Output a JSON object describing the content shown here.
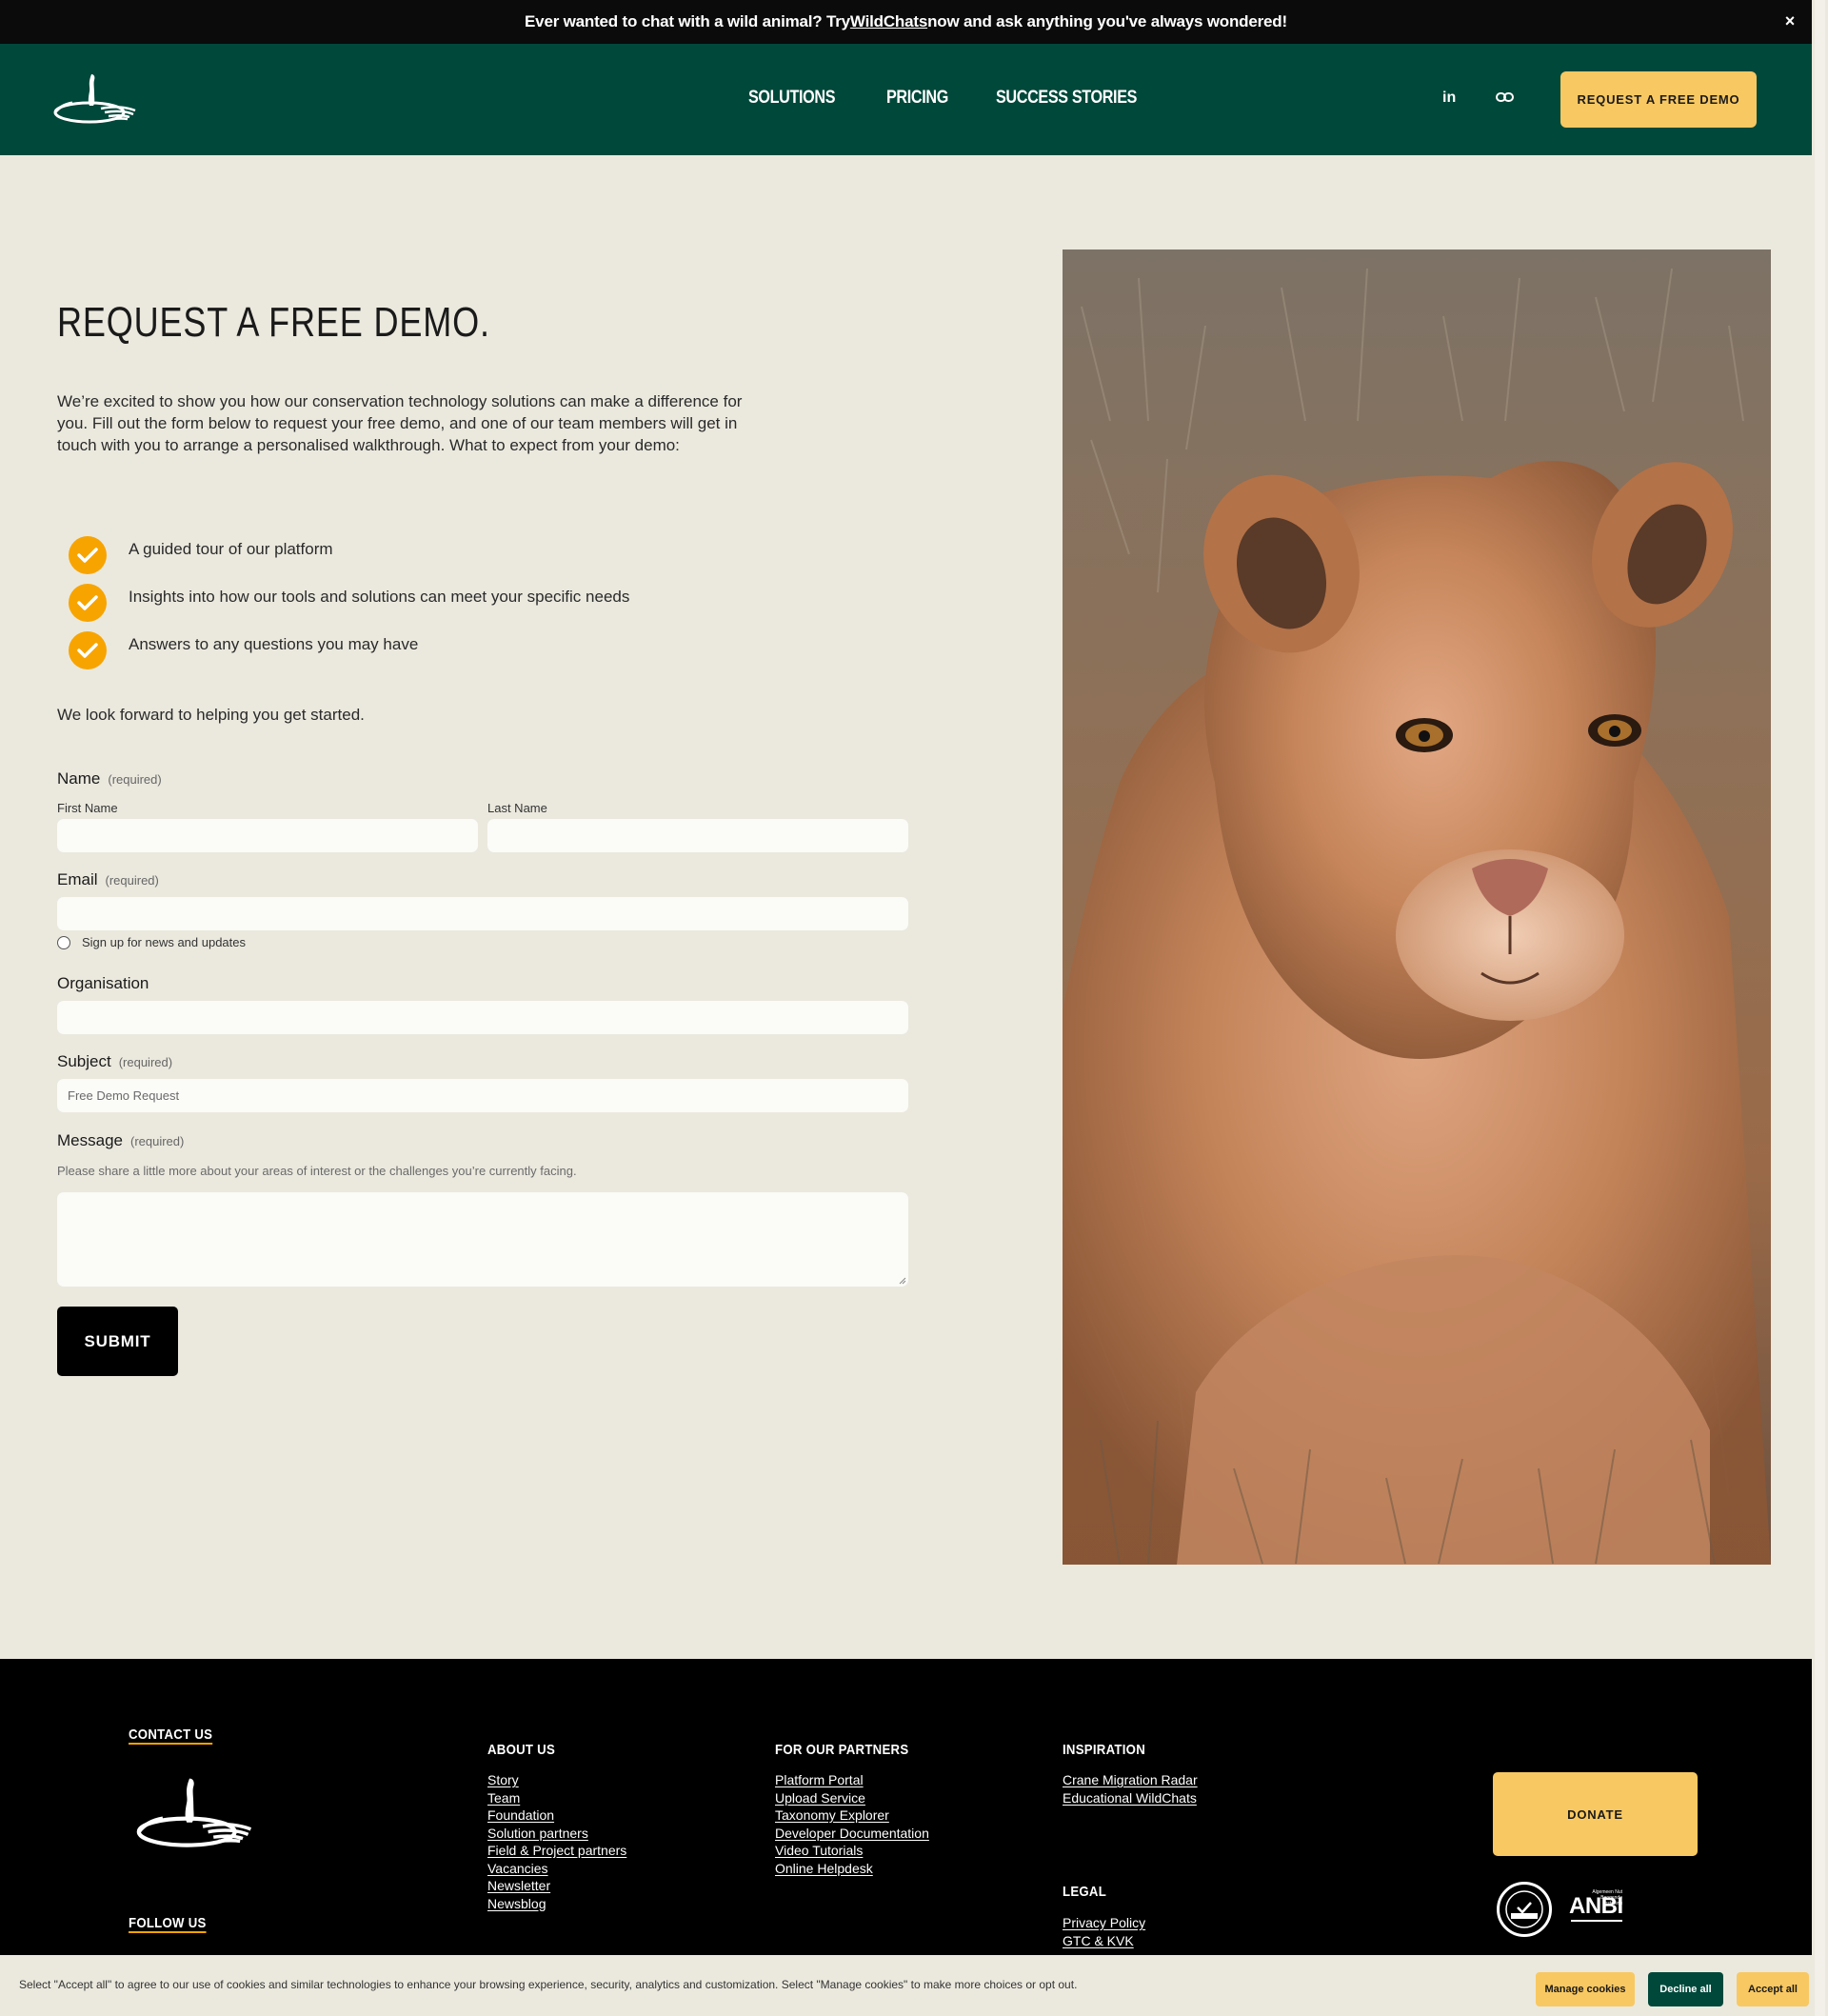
{
  "banner": {
    "text_before": "Ever wanted to chat with a wild animal? Try ",
    "link": "WildChats",
    "text_after": " now and ask anything you've always wondered!",
    "close": "×"
  },
  "header": {
    "nav": [
      "SOLUTIONS",
      "PRICING",
      "SUCCESS STORIES"
    ],
    "social_linkedin": "in",
    "cta": "REQUEST A FREE DEMO"
  },
  "main": {
    "title": "REQUEST A FREE DEMO.",
    "intro": "We’re excited to show you how our conservation technology solutions can make a difference for you. Fill out the form below to request your free demo, and one of our team members will get in touch with you to arrange a personalised walkthrough. What to expect from your demo:",
    "checklist": [
      "A guided tour of our platform",
      "Insights into how our tools and solutions can meet your specific needs",
      "Answers to any questions you may have"
    ],
    "closing": "We look forward to helping you get started."
  },
  "form": {
    "name_label": "Name",
    "required": "(required)",
    "first_name": "First Name",
    "last_name": "Last Name",
    "email_label": "Email",
    "newsletter": "Sign up for news and updates",
    "org_label": "Organisation",
    "subject_label": "Subject",
    "subject_placeholder": "Free Demo Request",
    "message_label": "Message",
    "message_help": "Please share a little more about your areas of interest or the challenges you’re currently facing.",
    "submit": "SUBMIT"
  },
  "footer": {
    "contact": "CONTACT US",
    "follow": "FOLLOW US",
    "about_title": "ABOUT US",
    "about": [
      "Story",
      "Team",
      "Foundation",
      "Solution partners",
      "Field & Project partners",
      "Vacancies",
      "Newsletter",
      "Newsblog"
    ],
    "partners_title": "FOR OUR PARTNERS",
    "partners": [
      "Platform Portal",
      "Upload Service",
      "Taxonomy Explorer",
      "Developer Documentation",
      "Video Tutorials",
      "Online Helpdesk"
    ],
    "inspiration_title": "INSPIRATION",
    "inspiration": [
      "Crane Migration Radar",
      "Educational WildChats"
    ],
    "legal_title": "LEGAL",
    "legal": [
      "Privacy Policy",
      "GTC & KVK"
    ],
    "donate": "DONATE",
    "anbi": "ANBI",
    "anbi_small": "Algemeen Nut Beogende Instelling"
  },
  "cookie": {
    "message": "Select \"Accept all\" to agree to our use of cookies and similar technologies to enhance your browsing experience, security, analytics and customization. Select \"Manage cookies\" to make more choices or opt out.",
    "manage": "Manage cookies",
    "decline": "Decline all",
    "accept": "Accept all"
  },
  "colors": {
    "header_green": "#00483a",
    "accent_yellow": "#f8c862",
    "check_orange": "#f7a400",
    "page_bg": "#ebe9de"
  }
}
